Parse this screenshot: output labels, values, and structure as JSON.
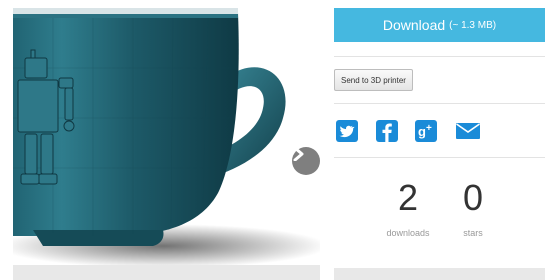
{
  "preview": {
    "next_icon": "chevron-right-icon"
  },
  "download": {
    "label": "Download",
    "size": "(~ 1.3 MB)",
    "color": "#45b8e0"
  },
  "send_to_printer": {
    "label": "Send to 3D printer"
  },
  "share": {
    "icons": [
      "twitter-icon",
      "facebook-icon",
      "google-plus-icon",
      "email-icon"
    ],
    "color": "#1a8bd8"
  },
  "stats": {
    "downloads_value": "2",
    "downloads_label": "downloads",
    "stars_value": "0",
    "stars_label": "stars"
  }
}
